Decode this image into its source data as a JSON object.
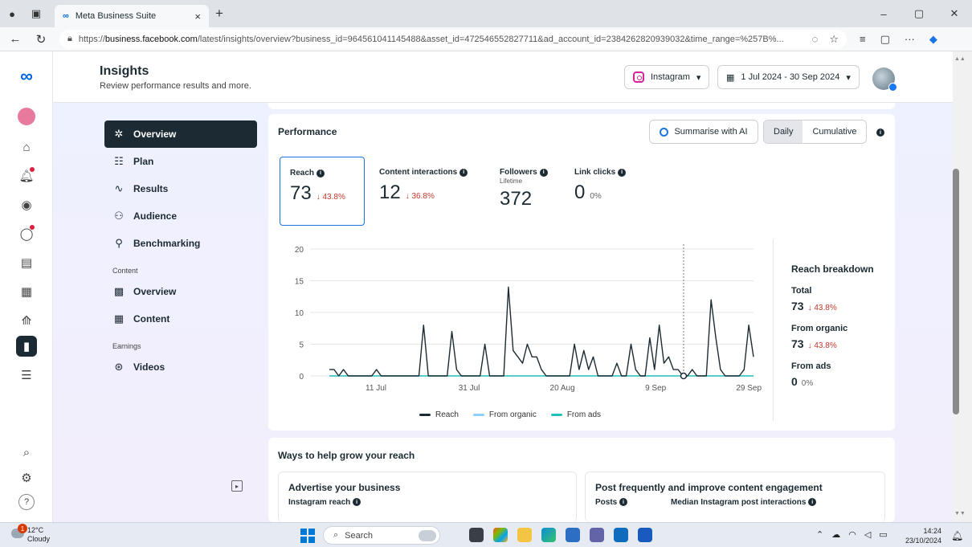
{
  "browser": {
    "tab_title": "Meta Business Suite",
    "tab_close": "×",
    "new_tab": "+",
    "url_prefix": "https://",
    "url_host": "business.facebook.com",
    "url_path": "/latest/insights/overview?business_id=964561041145488&asset_id=472546552827711&ad_account_id=2384262820939032&time_range=%257B%...",
    "win_min": "–",
    "win_max": "▢",
    "win_close": "✕"
  },
  "header": {
    "title": "Insights",
    "subtitle": "Review performance results and more.",
    "platform": "Instagram",
    "date_range": "1 Jul 2024 - 30 Sep 2024"
  },
  "subnav": {
    "items": [
      {
        "label": "Overview",
        "icon": "sparkle-icon"
      },
      {
        "label": "Plan",
        "icon": "list-icon"
      },
      {
        "label": "Results",
        "icon": "trend-icon"
      },
      {
        "label": "Audience",
        "icon": "people-icon"
      },
      {
        "label": "Benchmarking",
        "icon": "compare-icon"
      }
    ],
    "section_content": "Content",
    "content_items": [
      {
        "label": "Overview",
        "icon": "gallery-icon"
      },
      {
        "label": "Content",
        "icon": "table-icon"
      }
    ],
    "section_earnings": "Earnings",
    "earnings_items": [
      {
        "label": "Videos",
        "icon": "dollar-icon"
      }
    ]
  },
  "performance": {
    "title": "Performance",
    "ai_button": "Summarise with AI",
    "daily": "Daily",
    "cumulative": "Cumulative",
    "metrics": [
      {
        "label": "Reach",
        "value": "73",
        "change": "↓ 43.8%"
      },
      {
        "label": "Content interactions",
        "value": "12",
        "change": "↓ 36.8%"
      },
      {
        "label": "Followers",
        "sub": "Lifetime",
        "value": "372"
      },
      {
        "label": "Link clicks",
        "value": "0",
        "change": "0%"
      }
    ],
    "legend": [
      "Reach",
      "From organic",
      "From ads"
    ],
    "breakdown": {
      "title": "Reach breakdown",
      "total_label": "Total",
      "total_value": "73",
      "total_change": "↓ 43.8%",
      "organic_label": "From organic",
      "organic_value": "73",
      "organic_change": "↓ 43.8%",
      "ads_label": "From ads",
      "ads_value": "0",
      "ads_change": "0%"
    }
  },
  "chart_data": {
    "type": "line",
    "x_ticks": [
      "11 Jul",
      "31 Jul",
      "20 Aug",
      "9 Sep",
      "29 Sep"
    ],
    "y_ticks": [
      0,
      5,
      10,
      15,
      20
    ],
    "ylim": [
      0,
      20
    ],
    "x_start": "2024-07-01",
    "x_end": "2024-09-30",
    "series": [
      {
        "name": "Reach",
        "color": "#1c2b33",
        "values": [
          1,
          1,
          0,
          1,
          0,
          0,
          0,
          0,
          0,
          0,
          1,
          0,
          0,
          0,
          0,
          0,
          0,
          0,
          0,
          0,
          8,
          0,
          0,
          0,
          0,
          0,
          7,
          1,
          0,
          0,
          0,
          0,
          0,
          5,
          0,
          0,
          0,
          0,
          14,
          4,
          3,
          2,
          5,
          3,
          3,
          1,
          0,
          0,
          0,
          0,
          0,
          0,
          5,
          1,
          4,
          1,
          3,
          0,
          0,
          0,
          0,
          2,
          0,
          0,
          5,
          1,
          0,
          0,
          6,
          1,
          8,
          2,
          3,
          1,
          1,
          0,
          0,
          1,
          0,
          0,
          0,
          12,
          6,
          1,
          0,
          0,
          0,
          0,
          1,
          8,
          3
        ]
      },
      {
        "name": "From organic",
        "color": "#8ed1f5",
        "values": []
      },
      {
        "name": "From ads",
        "color": "#20c1b8",
        "values": []
      }
    ],
    "marker_date": "2024-09-15"
  },
  "grow": {
    "title": "Ways to help grow your reach",
    "card1_title": "Advertise your business",
    "card1_sub": "Instagram reach",
    "card2_title": "Post frequently and improve content engagement",
    "card2_sub1": "Posts",
    "card2_sub2": "Median Instagram post interactions"
  },
  "taskbar": {
    "temp": "12°C",
    "weather": "Cloudy",
    "badge": "1",
    "search": "Search",
    "time": "14:24",
    "date": "23/10/2024"
  }
}
